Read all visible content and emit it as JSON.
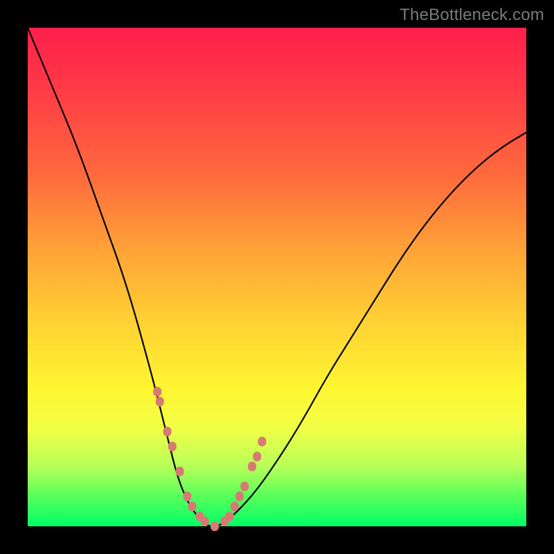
{
  "watermark": "TheBottleneck.com",
  "chart_data": {
    "type": "line",
    "title": "",
    "xlabel": "",
    "ylabel": "",
    "xlim": [
      0,
      1
    ],
    "ylim": [
      0,
      1
    ],
    "series": [
      {
        "name": "bottleneck-curve",
        "x": [
          0.0,
          0.05,
          0.1,
          0.15,
          0.2,
          0.25,
          0.28,
          0.3,
          0.32,
          0.34,
          0.36,
          0.38,
          0.4,
          0.45,
          0.5,
          0.55,
          0.6,
          0.65,
          0.7,
          0.75,
          0.8,
          0.85,
          0.9,
          0.95,
          1.0
        ],
        "y": [
          1.0,
          0.88,
          0.76,
          0.62,
          0.48,
          0.3,
          0.18,
          0.1,
          0.05,
          0.02,
          0.0,
          0.0,
          0.01,
          0.06,
          0.13,
          0.21,
          0.3,
          0.38,
          0.46,
          0.54,
          0.61,
          0.67,
          0.72,
          0.76,
          0.79
        ]
      }
    ],
    "highlight_points": {
      "name": "salmon-dots",
      "color": "#d87a74",
      "x": [
        0.26,
        0.265,
        0.28,
        0.29,
        0.305,
        0.32,
        0.33,
        0.345,
        0.355,
        0.375,
        0.395,
        0.405,
        0.415,
        0.425,
        0.435,
        0.45,
        0.46,
        0.47
      ],
      "y": [
        0.27,
        0.25,
        0.19,
        0.16,
        0.11,
        0.06,
        0.04,
        0.02,
        0.01,
        0.0,
        0.01,
        0.02,
        0.04,
        0.06,
        0.08,
        0.12,
        0.14,
        0.17
      ]
    }
  }
}
